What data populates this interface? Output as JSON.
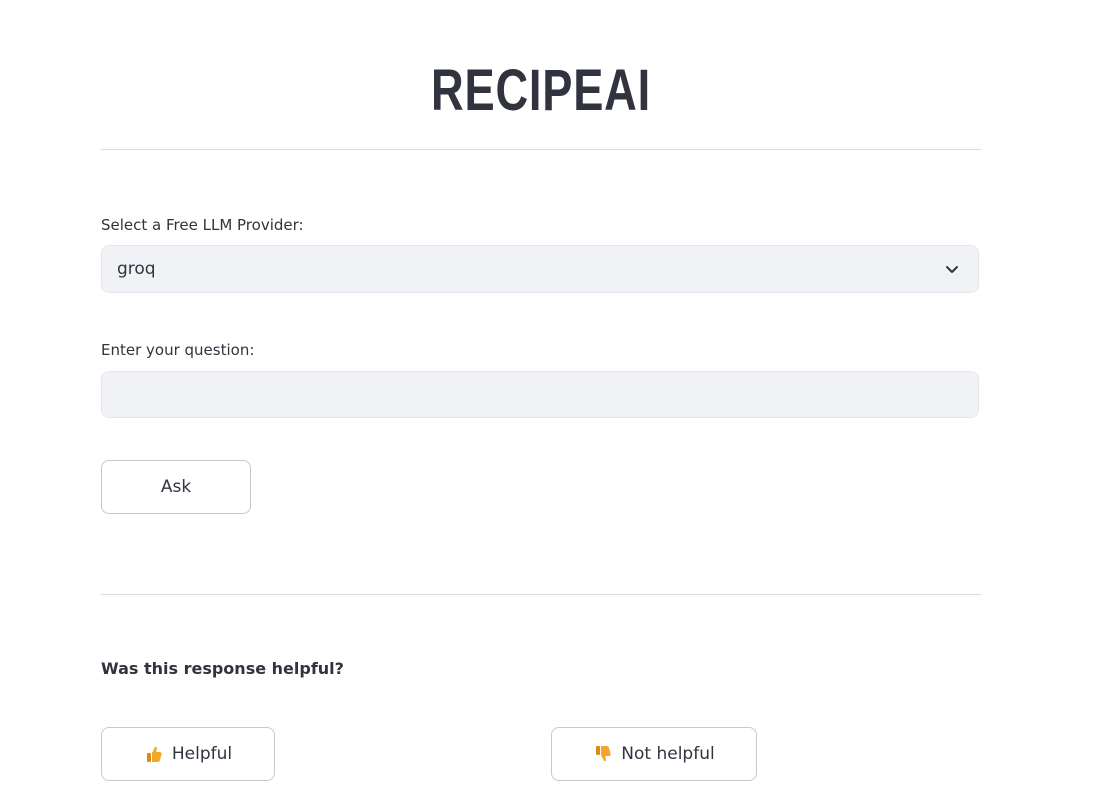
{
  "app": {
    "title": "RECIPEAI"
  },
  "provider": {
    "label": "Select a Free LLM Provider:",
    "selected": "groq"
  },
  "question": {
    "label": "Enter your question:",
    "value": "",
    "placeholder": ""
  },
  "ask_button": {
    "label": "Ask"
  },
  "feedback": {
    "question": "Was this response helpful?",
    "helpful_label": "Helpful",
    "not_helpful_label": "Not helpful",
    "helpful_icon": "thumbs-up-icon",
    "not_helpful_icon": "thumbs-down-icon"
  },
  "colors": {
    "text": "#31333f",
    "input_bg": "#f0f2f6",
    "divider": "#dcdcdf",
    "thumb": "#f4a62a"
  }
}
